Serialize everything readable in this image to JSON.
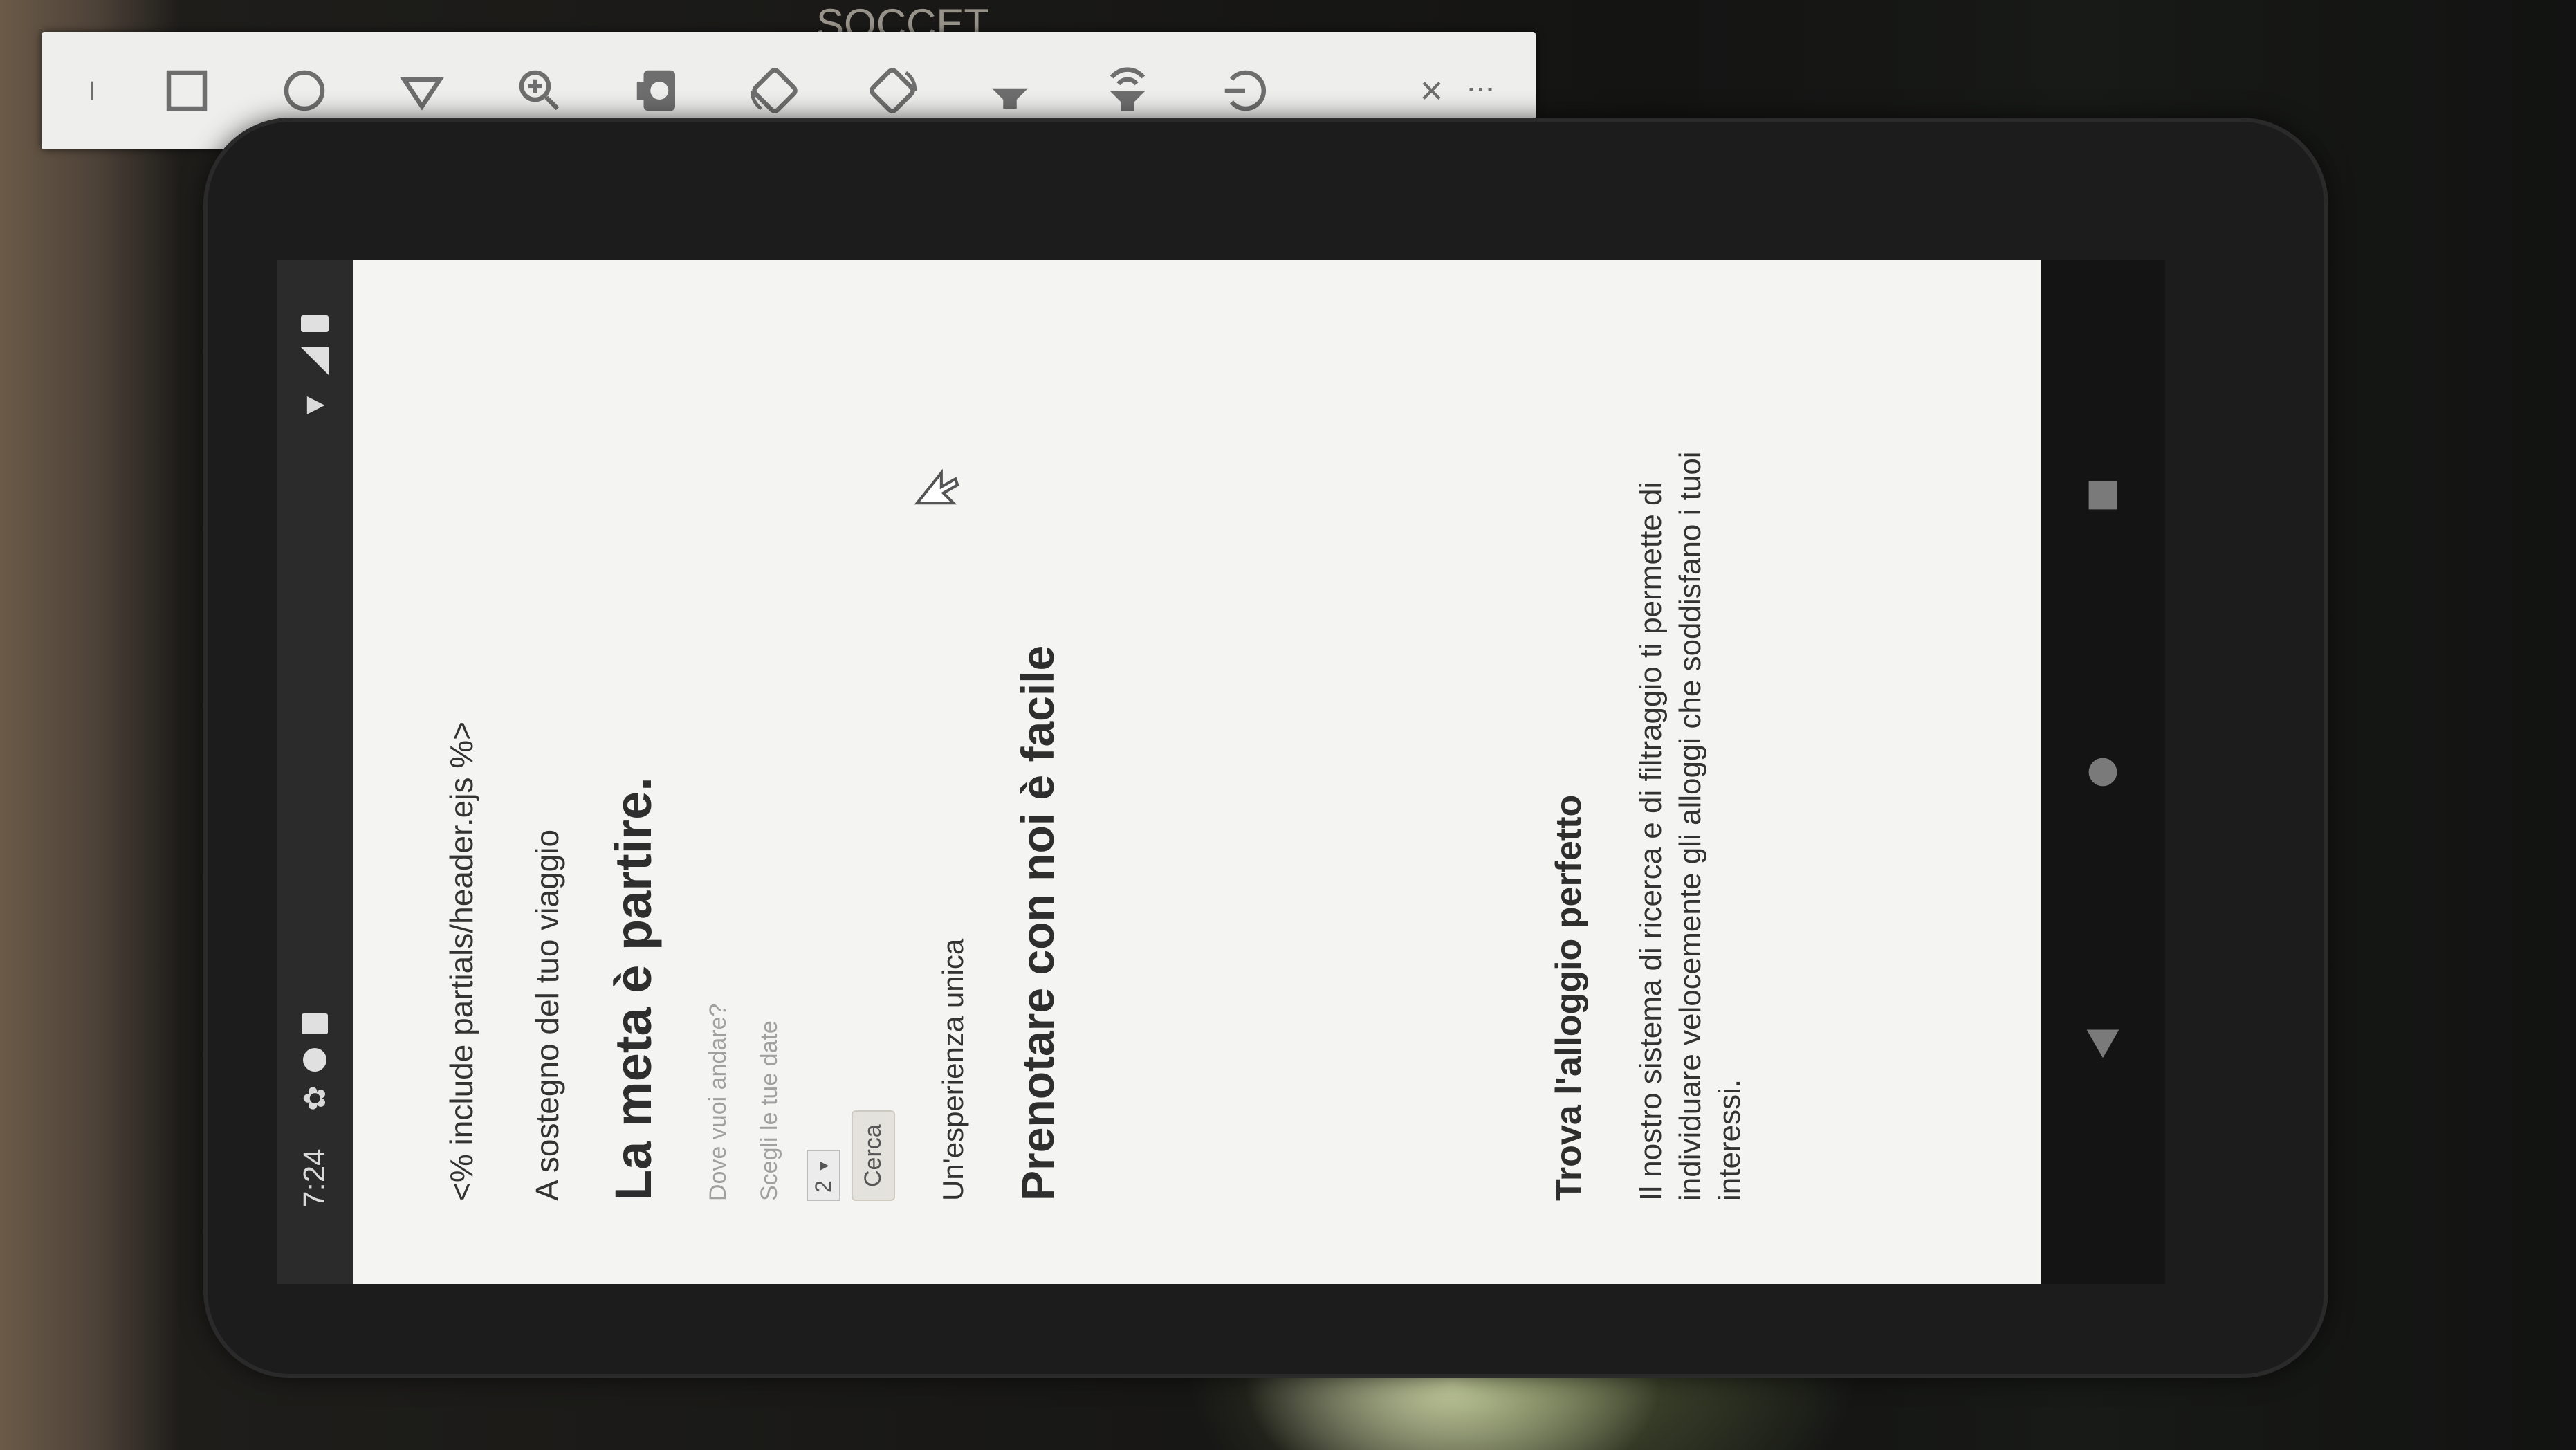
{
  "status_bar": {
    "time": "7:24"
  },
  "page": {
    "include_directive": "<% include partials/header.ejs %>",
    "tagline": "A sostegno del tuo viaggio",
    "headline": "La meta è partire.",
    "search": {
      "destination_placeholder": "Dove vuoi andare?",
      "dates_placeholder": "Scegli le tue date",
      "guests_value": "2",
      "submit_label": "Cerca"
    },
    "experience_label": "Un'esperienza unica",
    "booking_heading": "Prenotare con noi è facile",
    "feature_title": "Trova l'alloggio perfetto",
    "feature_text": "Il nostro sistema di ricerca e di filtraggio ti permette di individuare velocemente gli alloggi che soddisfano i tuoi interessi."
  },
  "emulator_toolbar": {
    "minimize_label": "–",
    "close_label": "×",
    "buttons": [
      "power-icon",
      "volume-up-icon",
      "volume-down-icon",
      "rotate-left-icon",
      "rotate-right-icon",
      "camera-icon",
      "zoom-icon",
      "back-icon",
      "home-icon",
      "overview-icon",
      "more-icon"
    ]
  },
  "background_text": "SOCCET",
  "colors": {
    "screen_bg": "#f4f4f2",
    "status_bar_bg": "#2b2b2b",
    "toolbar_bg": "#eeefed",
    "phone_body": "#1c1c1c"
  }
}
